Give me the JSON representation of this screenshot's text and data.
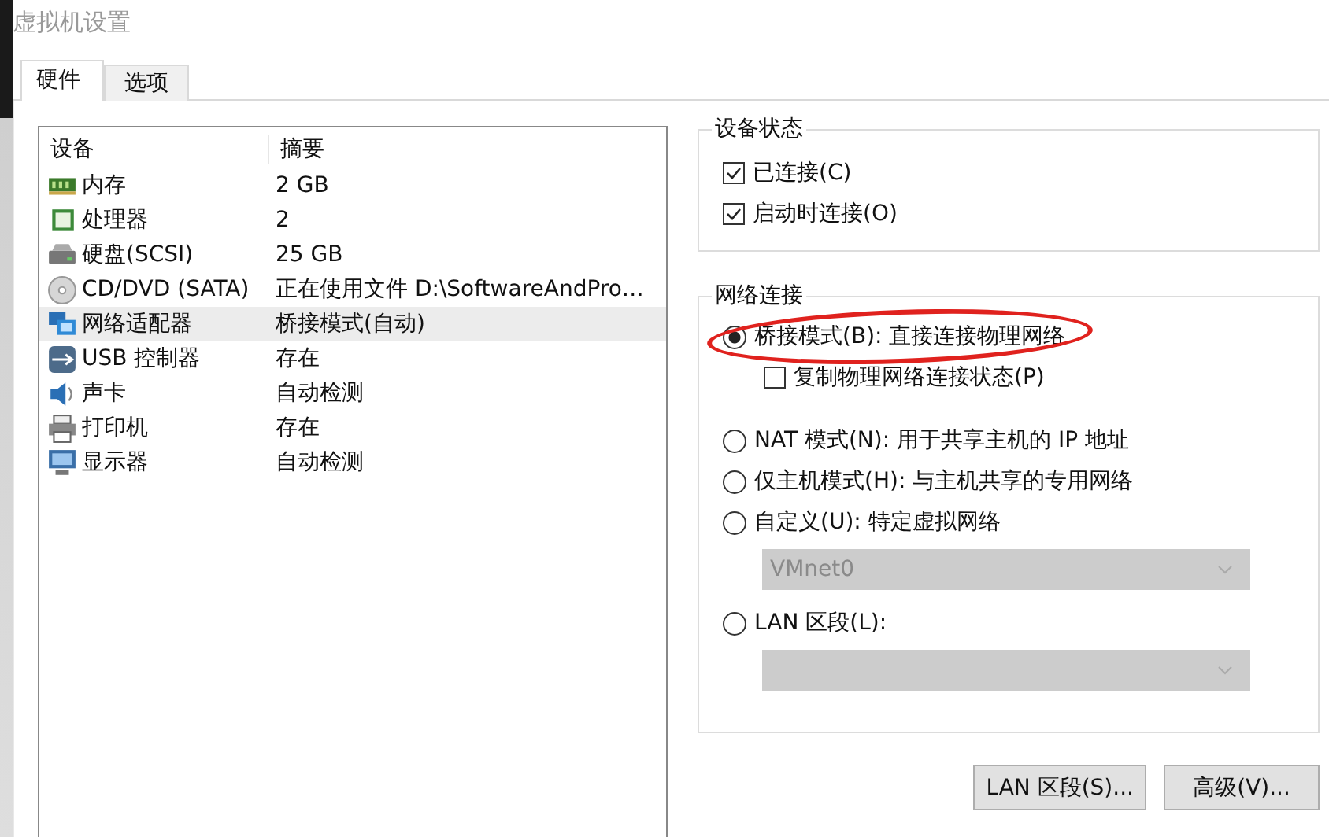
{
  "window": {
    "title": "虚拟机设置"
  },
  "tabs": [
    {
      "label": "硬件",
      "selected": true
    },
    {
      "label": "选项",
      "selected": false
    }
  ],
  "device_table": {
    "columns": [
      "设备",
      "摘要"
    ],
    "rows": [
      {
        "kind": "memory",
        "device": "内存",
        "summary": "2 GB",
        "selected": false
      },
      {
        "kind": "cpu",
        "device": "处理器",
        "summary": "2",
        "selected": false
      },
      {
        "kind": "disk",
        "device": "硬盘(SCSI)",
        "summary": "25 GB",
        "selected": false
      },
      {
        "kind": "cd",
        "device": "CD/DVD (SATA)",
        "summary": "正在使用文件 D:\\SoftwareAndPro…",
        "selected": false
      },
      {
        "kind": "network",
        "device": "网络适配器",
        "summary": "桥接模式(自动)",
        "selected": true
      },
      {
        "kind": "usb",
        "device": "USB 控制器",
        "summary": "存在",
        "selected": false
      },
      {
        "kind": "sound",
        "device": "声卡",
        "summary": "自动检测",
        "selected": false
      },
      {
        "kind": "printer",
        "device": "打印机",
        "summary": "存在",
        "selected": false
      },
      {
        "kind": "monitor",
        "device": "显示器",
        "summary": "自动检测",
        "selected": false
      }
    ]
  },
  "device_status": {
    "title": "设备状态",
    "options": [
      {
        "label": "已连接(C)",
        "checked": true
      },
      {
        "label": "启动时连接(O)",
        "checked": true
      }
    ]
  },
  "network_connection": {
    "title": "网络连接",
    "options": [
      {
        "kind": "radio",
        "label": "桥接模式(B): 直接连接物理网络",
        "selected": true,
        "highlighted": true
      },
      {
        "kind": "checkbox",
        "label": "复制物理网络连接状态(P)",
        "checked": false
      },
      {
        "kind": "radio",
        "label": "NAT 模式(N): 用于共享主机的 IP 地址",
        "selected": false
      },
      {
        "kind": "radio",
        "label": "仅主机模式(H): 与主机共享的专用网络",
        "selected": false
      },
      {
        "kind": "radio",
        "label": "自定义(U): 特定虚拟网络",
        "selected": false
      },
      {
        "kind": "dropdown",
        "value": "VMnet0",
        "disabled": true
      },
      {
        "kind": "radio",
        "label": "LAN 区段(L):",
        "selected": false
      },
      {
        "kind": "dropdown",
        "disabled": true
      }
    ]
  },
  "buttons": [
    "LAN 区段(S)...",
    "高级(V)..."
  ]
}
